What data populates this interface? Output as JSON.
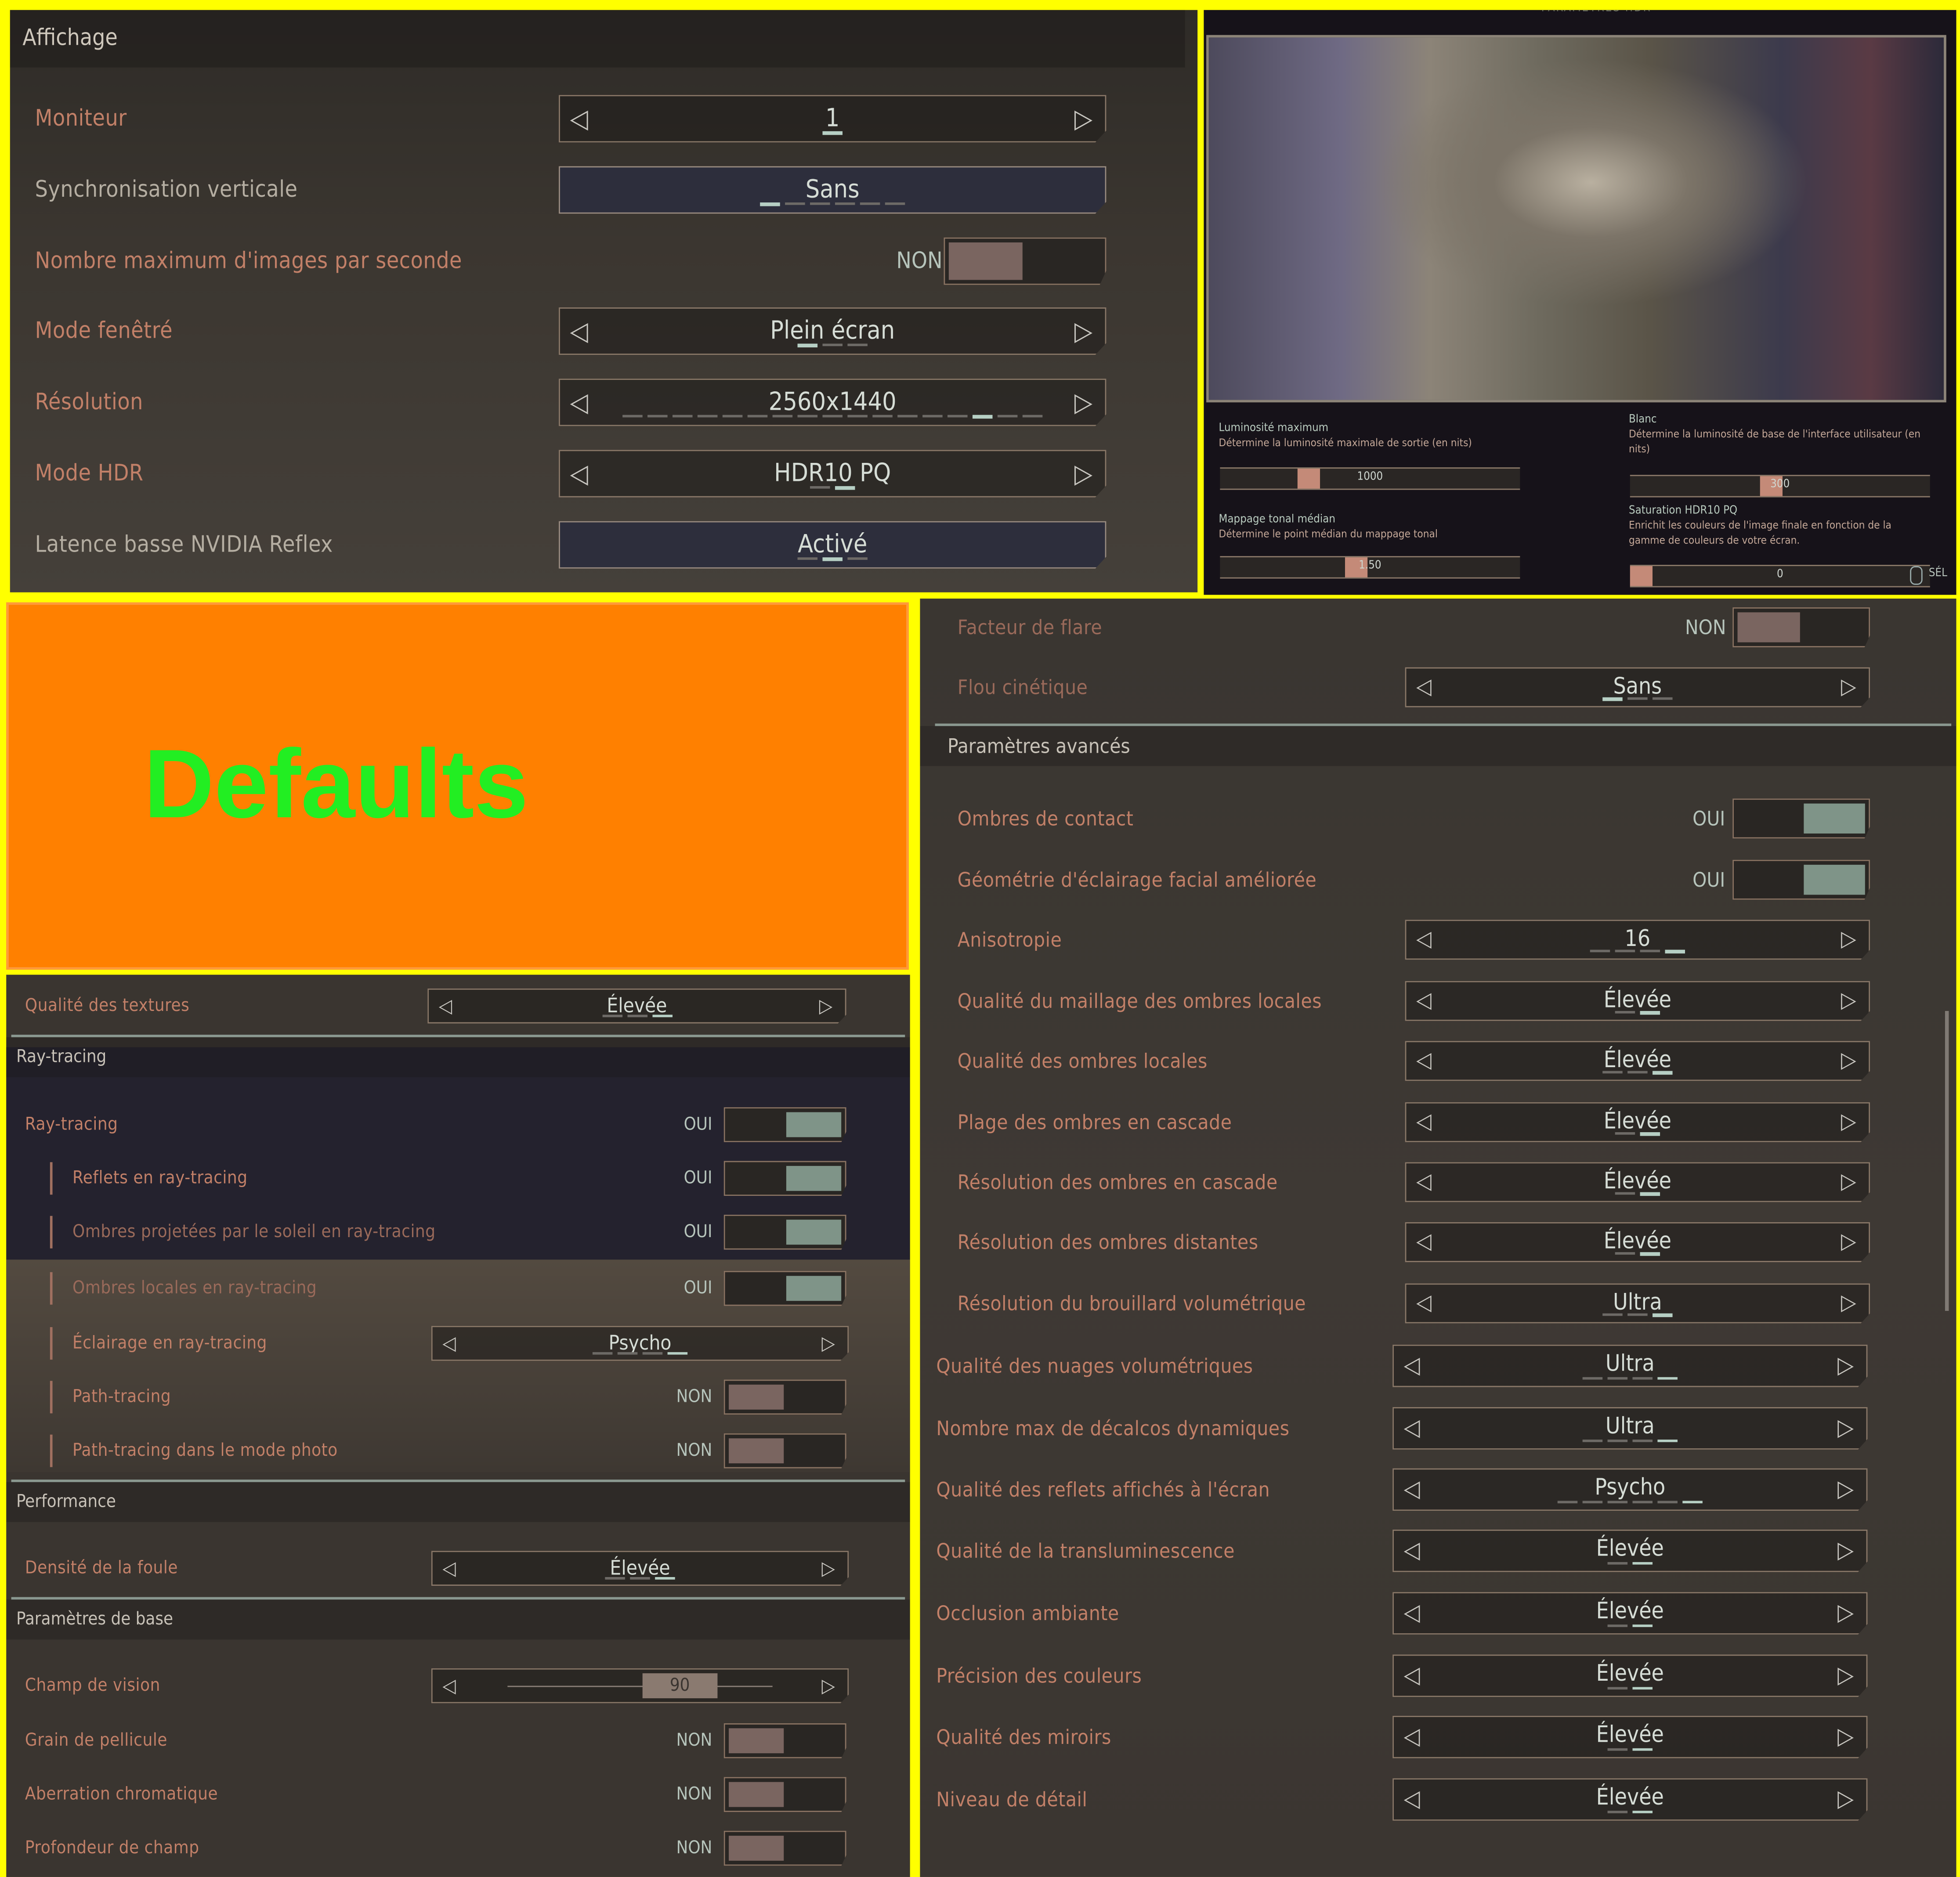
{
  "display": {
    "title": "Affichage",
    "rows": [
      {
        "type": "select",
        "label": "Moniteur",
        "value": "1",
        "dots": 1,
        "active": 0
      },
      {
        "type": "button",
        "label": "Synchronisation verticale",
        "value": "Sans",
        "dots": 6,
        "active": 0,
        "grey": true
      },
      {
        "type": "toggle",
        "label": "Nombre maximum d'images par seconde",
        "state": "NON",
        "on": false
      },
      {
        "type": "select",
        "label": "Mode fenêtré",
        "value": "Plein écran"
      },
      {
        "type": "select",
        "label": "Résolution",
        "value": "2560x1440",
        "dots": 17,
        "active": 14
      },
      {
        "type": "select",
        "label": "Mode HDR",
        "value": "HDR10 PQ",
        "dots": 2,
        "active": 1
      },
      {
        "type": "button",
        "label": "Latence basse NVIDIA Reflex",
        "value": "Activé",
        "dots": 3,
        "active": 1,
        "grey": true
      }
    ]
  },
  "hdr": {
    "header": "PARAMÈTRES HDR",
    "settings": [
      {
        "title": "Luminosité maximum",
        "desc": "Détermine la luminosité maximale de sortie (en nits)",
        "value": "1000",
        "level": 0.28
      },
      {
        "title": "Blanc",
        "desc": "Détermine la luminosité de base de l'interface utilisateur (en nits)",
        "value": "300",
        "level": 0.47
      },
      {
        "title": "Mappage tonal médian",
        "desc": "Détermine le point médian du mappage tonal",
        "value": "1.50",
        "level": 0.45
      },
      {
        "title": "Saturation HDR10 PQ",
        "desc": "Enrichit les couleurs de l'image finale en fonction de la gamme de couleurs de votre écran.",
        "value": "0",
        "level": 0.0
      }
    ],
    "select_hint": "SÉL"
  },
  "banner": {
    "text": "Defaults",
    "bg": "#ff8000",
    "color": "#22ee22"
  },
  "left": {
    "rows": [
      {
        "type": "select",
        "label": "Qualité des textures",
        "value": "Élevée",
        "dots": 3,
        "active": 2
      },
      {
        "type": "section",
        "label": "Ray-tracing"
      },
      {
        "type": "toggle",
        "label": "Ray-tracing",
        "state": "OUI",
        "on": true
      },
      {
        "type": "toggle",
        "label": "Reflets en ray-tracing",
        "state": "OUI",
        "on": true,
        "indent": true
      },
      {
        "type": "toggle",
        "label": "Ombres projetées par le soleil en ray-tracing",
        "state": "OUI",
        "on": true,
        "indent": true,
        "dim": true
      },
      {
        "type": "toggle",
        "label": "Ombres locales en ray-tracing",
        "state": "OUI",
        "on": true,
        "indent": true,
        "dim": true
      },
      {
        "type": "select",
        "label": "Éclairage en ray-tracing",
        "value": "Psycho",
        "dots": 4,
        "active": 3,
        "indent": true
      },
      {
        "type": "toggle",
        "label": "Path-tracing",
        "state": "NON",
        "on": false,
        "indent": true
      },
      {
        "type": "toggle",
        "label": "Path-tracing dans le mode photo",
        "state": "NON",
        "on": false,
        "indent": true
      },
      {
        "type": "section",
        "label": "Performance"
      },
      {
        "type": "select",
        "label": "Densité de la foule",
        "value": "Élevée",
        "dots": 3,
        "active": 2
      },
      {
        "type": "section",
        "label": "Paramètres de base"
      },
      {
        "type": "slider",
        "label": "Champ de vision",
        "value": "90",
        "level": 0.65
      },
      {
        "type": "toggle",
        "label": "Grain de pellicule",
        "state": "NON",
        "on": false
      },
      {
        "type": "toggle",
        "label": "Aberration chromatique",
        "state": "NON",
        "on": false
      },
      {
        "type": "toggle",
        "label": "Profondeur de champ",
        "state": "NON",
        "on": false
      }
    ]
  },
  "right": {
    "rows": [
      {
        "type": "toggle",
        "label": "Facteur de flare",
        "state": "NON",
        "on": false,
        "dim": true
      },
      {
        "type": "select",
        "label": "Flou cinétique",
        "value": "Sans",
        "dots": 3,
        "active": 0,
        "dim": true
      },
      {
        "type": "section",
        "label": "Paramètres avancés"
      },
      {
        "type": "toggle",
        "label": "Ombres de contact",
        "state": "OUI",
        "on": true
      },
      {
        "type": "toggle",
        "label": "Géométrie d'éclairage facial améliorée",
        "state": "OUI",
        "on": true
      },
      {
        "type": "select",
        "label": "Anisotropie",
        "value": "16",
        "dots": 4,
        "active": 3
      },
      {
        "type": "select",
        "label": "Qualité du maillage des ombres locales",
        "value": "Élevée",
        "dots": 2,
        "active": 1
      },
      {
        "type": "select",
        "label": "Qualité des ombres locales",
        "value": "Élevée",
        "dots": 3,
        "active": 2
      },
      {
        "type": "select",
        "label": "Plage des ombres en cascade",
        "value": "Élevée",
        "dots": 2,
        "active": 1
      },
      {
        "type": "select",
        "label": "Résolution des ombres en cascade",
        "value": "Élevée",
        "dots": 2,
        "active": 1
      },
      {
        "type": "select",
        "label": "Résolution des ombres distantes",
        "value": "Élevée",
        "dots": 2,
        "active": 1
      },
      {
        "type": "select",
        "label": "Résolution du brouillard volumétrique",
        "value": "Ultra",
        "dots": 3,
        "active": 2
      },
      {
        "type": "select",
        "label": "Qualité des nuages volumétriques",
        "value": "Ultra",
        "dots": 4,
        "active": 3
      },
      {
        "type": "select",
        "label": "Nombre max de décalcos dynamiques",
        "value": "Ultra",
        "dots": 4,
        "active": 3
      },
      {
        "type": "select",
        "label": "Qualité des reflets affichés à l'écran",
        "value": "Psycho",
        "dots": 6,
        "active": 5
      },
      {
        "type": "select",
        "label": "Qualité de la transluminescence",
        "value": "Élevée",
        "dots": 2,
        "active": 1
      },
      {
        "type": "select",
        "label": "Occlusion ambiante",
        "value": "Élevée",
        "dots": 2,
        "active": 1
      },
      {
        "type": "select",
        "label": "Précision des couleurs",
        "value": "Élevée",
        "dots": 2,
        "active": 1
      },
      {
        "type": "select",
        "label": "Qualité des miroirs",
        "value": "Élevée",
        "dots": 2,
        "active": 1
      },
      {
        "type": "select",
        "label": "Niveau de détail",
        "value": "Élevée",
        "dots": 2,
        "active": 1
      }
    ]
  }
}
